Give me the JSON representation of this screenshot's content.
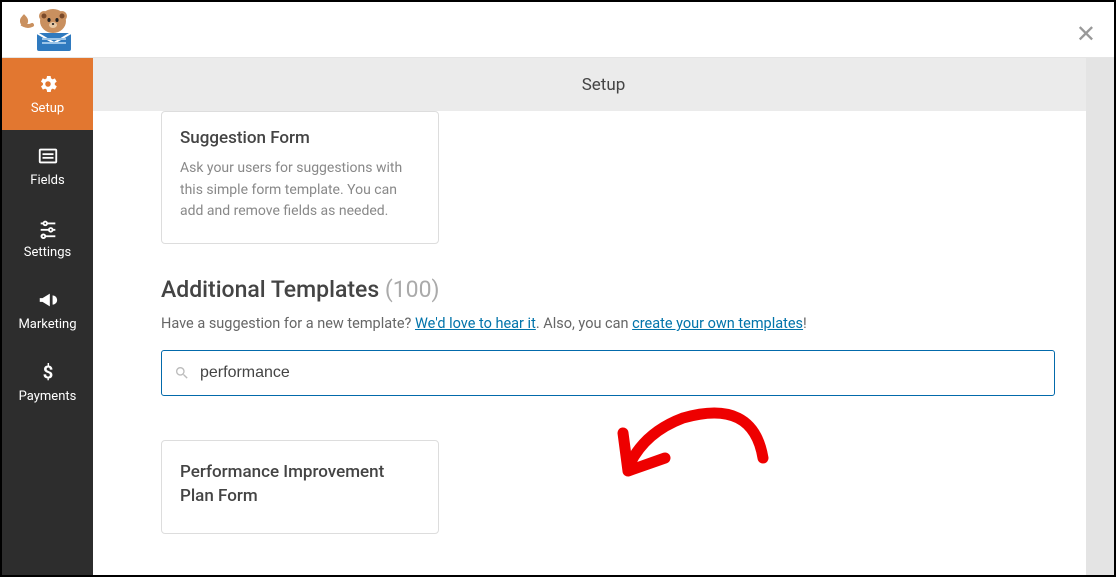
{
  "header": {
    "tab_label": "Setup"
  },
  "sidebar": {
    "items": [
      {
        "label": "Setup"
      },
      {
        "label": "Fields"
      },
      {
        "label": "Settings"
      },
      {
        "label": "Marketing"
      },
      {
        "label": "Payments"
      }
    ]
  },
  "top_card": {
    "title": "Suggestion Form",
    "description": "Ask your users for suggestions with this simple form template. You can add and remove fields as needed."
  },
  "section": {
    "title": "Additional Templates",
    "count": "(100)",
    "suggestion_prefix": "Have a suggestion for a new template? ",
    "link1": "We'd love to hear it",
    "middle": ". Also, you can ",
    "link2": "create your own templates",
    "suffix": "!"
  },
  "search": {
    "value": "performance"
  },
  "result": {
    "title": "Performance Improvement Plan Form"
  }
}
